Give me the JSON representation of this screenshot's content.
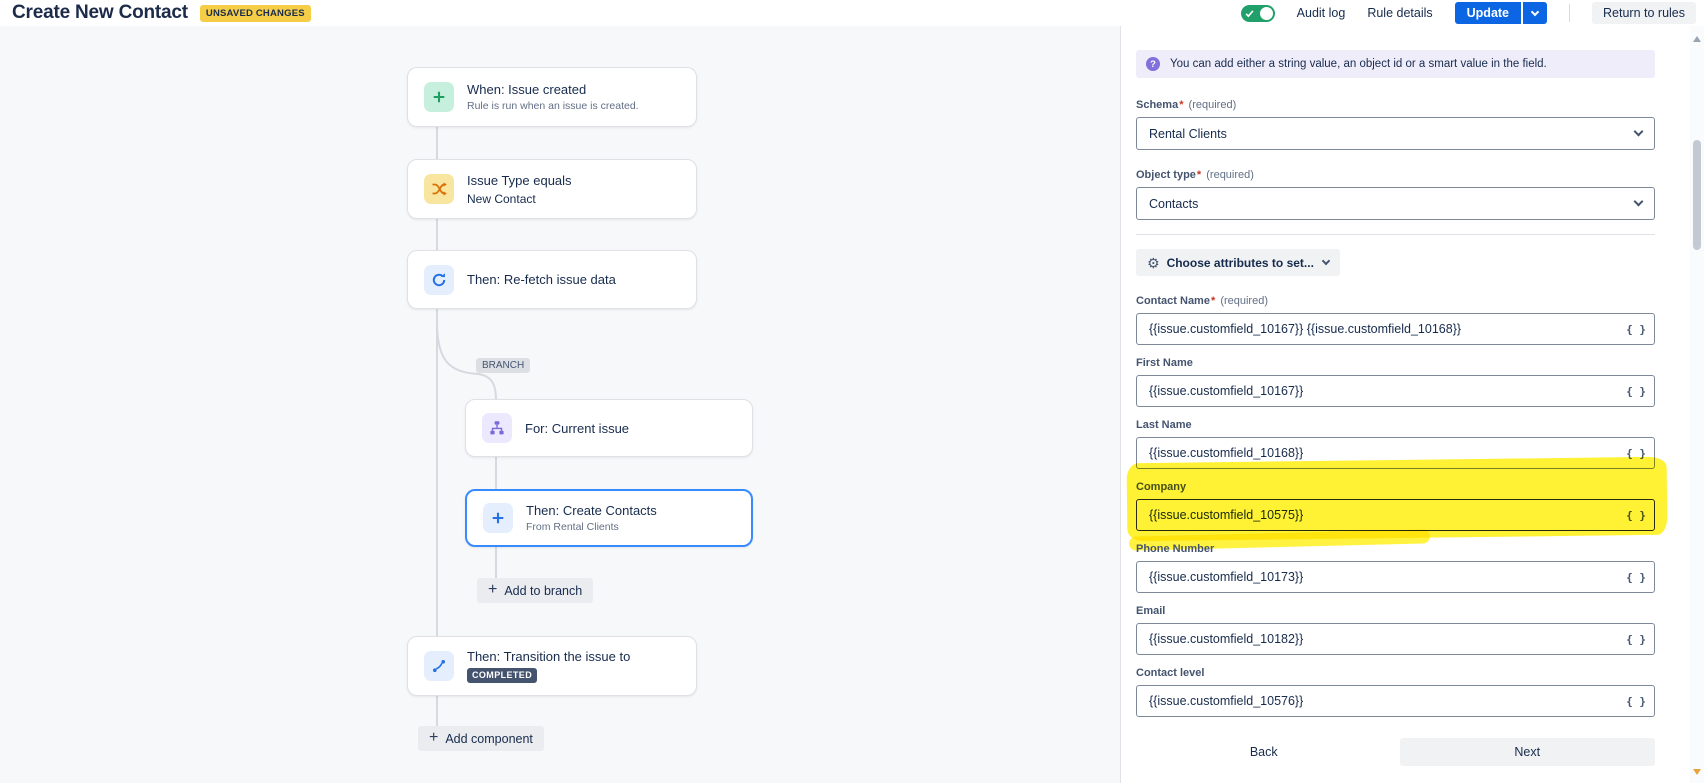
{
  "header": {
    "title": "Create New Contact",
    "unsaved_badge": "UNSAVED CHANGES",
    "audit_log": "Audit log",
    "rule_details": "Rule details",
    "update_label": "Update",
    "return_label": "Return to rules"
  },
  "flow": {
    "nodes": [
      {
        "title": "When: Issue created",
        "subtitle": "Rule is run when an issue is created.",
        "icon": "plus-green"
      },
      {
        "title": "Issue Type equals",
        "subtitle": "New Contact",
        "icon": "shuffle-orange"
      },
      {
        "title": "Then: Re-fetch issue data",
        "icon": "refresh-blue"
      },
      {
        "title": "For: Current issue",
        "icon": "hierarchy-purple"
      },
      {
        "title": "Then: Create Contacts",
        "subtitle": "From Rental Clients",
        "icon": "plus-blue",
        "selected": true
      },
      {
        "title": "Then: Transition the issue to",
        "badge": "COMPLETED",
        "icon": "transition-blue"
      }
    ],
    "branch_label": "BRANCH",
    "add_to_branch": "Add to branch",
    "add_component": "Add component"
  },
  "panel": {
    "info_banner": "You can add either a string value, an object id or a smart value in the field.",
    "schema": {
      "label": "Schema",
      "star": "*",
      "required_suffix": "(required)",
      "value": "Rental Clients"
    },
    "object_type": {
      "label": "Object type",
      "star": "*",
      "required_suffix": "(required)",
      "value": "Contacts"
    },
    "choose_attributes": "Choose attributes to set...",
    "braces": "{ }",
    "fields": [
      {
        "label": "Contact Name",
        "star": "*",
        "required_suffix": "(required)",
        "value": "{{issue.customfield_10167}} {{issue.customfield_10168}}"
      },
      {
        "label": "First Name",
        "value": "{{issue.customfield_10167}}"
      },
      {
        "label": "Last Name",
        "value": "{{issue.customfield_10168}}"
      },
      {
        "label": "Company",
        "value": "{{issue.customfield_10575}}",
        "highlighted": true
      },
      {
        "label": "Phone Number",
        "value": "{{issue.customfield_10173}}"
      },
      {
        "label": "Email",
        "value": "{{issue.customfield_10182}}"
      },
      {
        "label": "Contact level",
        "value": "{{issue.customfield_10576}}"
      }
    ],
    "back_label": "Back",
    "next_label": "Next"
  },
  "colors": {
    "accent_blue": "#0C66E4",
    "toggle_green": "#22A06B",
    "unsaved_badge_yellow": "#F5CD47",
    "highlight_yellow": "#FFEE00",
    "completed_badge": "#44546F",
    "canvas_bg": "#F7F8F9",
    "selected_node_border": "#388BFF",
    "banner_purple_bg": "#F0EDFB"
  }
}
